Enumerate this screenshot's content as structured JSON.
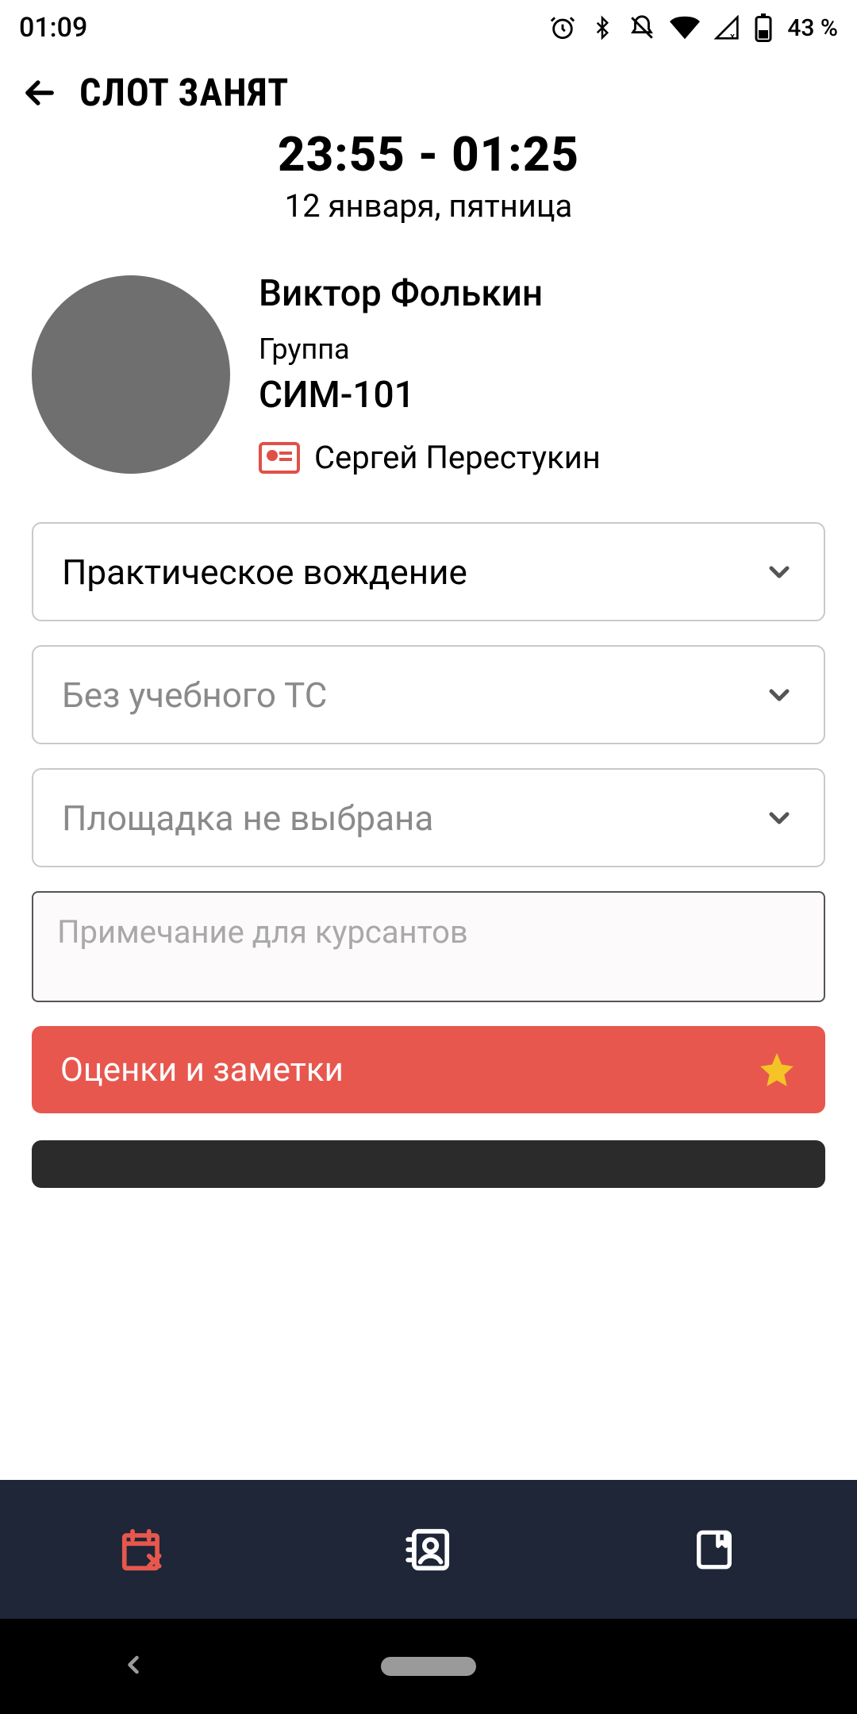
{
  "statusbar": {
    "time": "01:09",
    "battery": "43 %"
  },
  "appbar": {
    "title": "СЛОТ ЗАНЯТ"
  },
  "slot": {
    "time": "23:55 - 01:25",
    "date": "12 января, пятница"
  },
  "student": {
    "name": "Виктор Фолькин",
    "group_label": "Группа",
    "group_value": "СИМ-101",
    "instructor": "Сергей Перестукин"
  },
  "dropdowns": {
    "lesson_type": "Практическое вождение",
    "vehicle": "Без учебного ТС",
    "area": "Площадка не выбрана"
  },
  "note_placeholder": "Примечание для курсантов",
  "buttons": {
    "grades": "Оценки и заметки"
  }
}
